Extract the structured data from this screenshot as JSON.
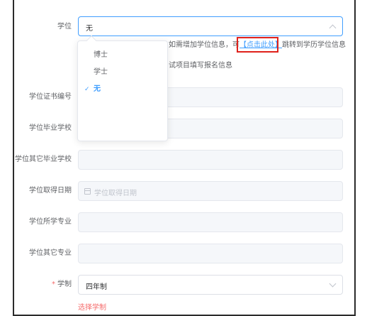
{
  "degree": {
    "label": "学位",
    "value": "无",
    "dropdown_options": [
      "博士",
      "学士",
      "无"
    ],
    "selected_option": "无",
    "hint_prefix": "如需增加学位信息，可",
    "hint_link": "【点击此处】",
    "hint_suffix": "跳转到学历学位信息",
    "hint_line2": "试项目填写报名信息"
  },
  "fields": {
    "cert_no": {
      "label": "学位证书编号"
    },
    "grad_school": {
      "label": "学位毕业学校"
    },
    "other_school": {
      "label": "学位其它毕业学校"
    },
    "date": {
      "label": "学位取得日期",
      "placeholder": "学位取得日期"
    },
    "major": {
      "label": "学位所学专业"
    },
    "other_major": {
      "label": "学位其它专业"
    }
  },
  "schooling": {
    "required_mark": "*",
    "label": "学制",
    "value": "四年制",
    "error": "选择学制"
  },
  "colors": {
    "accent": "#409eff",
    "error": "#f56c6c",
    "highlight_box": "#e0211b"
  }
}
